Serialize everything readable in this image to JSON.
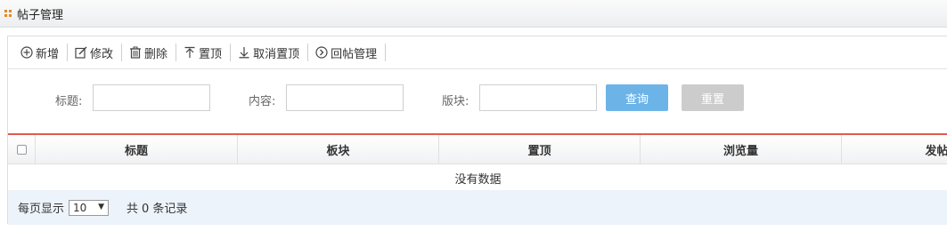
{
  "panel": {
    "title": "帖子管理"
  },
  "toolbar": {
    "buttons": [
      {
        "label": "新增",
        "icon": "plus-circle-icon"
      },
      {
        "label": "修改",
        "icon": "edit-icon"
      },
      {
        "label": "删除",
        "icon": "trash-icon"
      },
      {
        "label": "置顶",
        "icon": "arrow-up-icon"
      },
      {
        "label": "取消置顶",
        "icon": "arrow-down-icon"
      },
      {
        "label": "回帖管理",
        "icon": "chevron-circle-icon"
      }
    ]
  },
  "search": {
    "title_label": "标题:",
    "title_value": "",
    "content_label": "内容:",
    "content_value": "",
    "section_label": "版块:",
    "section_value": "",
    "query_label": "查询",
    "reset_label": "重置"
  },
  "grid": {
    "columns": [
      "标题",
      "板块",
      "置顶",
      "浏览量",
      "发帖用"
    ],
    "empty_text": "没有数据"
  },
  "pager": {
    "per_page_label": "每页显示",
    "page_size": "10",
    "total_prefix": "共",
    "total_count": "0",
    "total_suffix": "条记录"
  },
  "colors": {
    "accent": "#6cb4e8",
    "header_rule": "#e05a4f",
    "pager_bg": "#edf3fb",
    "panel_icon": "#e8891d"
  }
}
